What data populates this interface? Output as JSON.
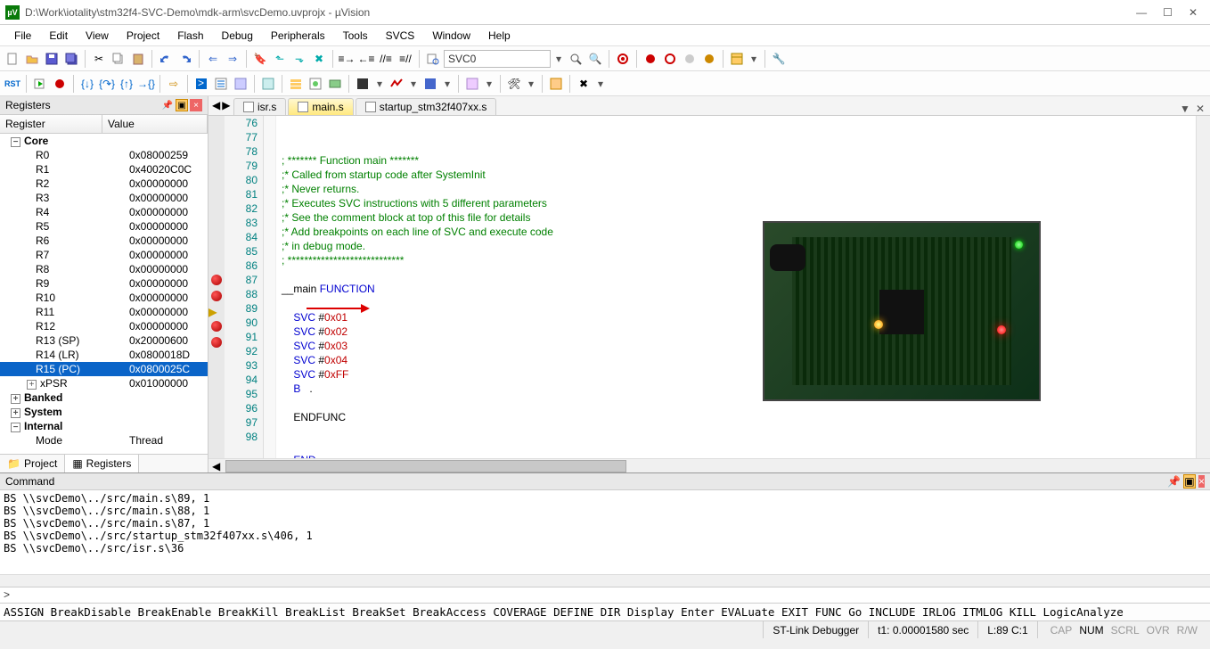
{
  "title": "D:\\Work\\iotality\\stm32f4-SVC-Demo\\mdk-arm\\svcDemo.uvprojx - µVision",
  "menus": [
    "File",
    "Edit",
    "View",
    "Project",
    "Flash",
    "Debug",
    "Peripherals",
    "Tools",
    "SVCS",
    "Window",
    "Help"
  ],
  "toolbar1_search_box": "SVC0",
  "registers": {
    "panel_title": "Registers",
    "col_name": "Register",
    "col_value": "Value",
    "groups": [
      {
        "name": "Core",
        "expanded": true,
        "children": [
          {
            "name": "R0",
            "value": "0x08000259"
          },
          {
            "name": "R1",
            "value": "0x40020C0C"
          },
          {
            "name": "R2",
            "value": "0x00000000"
          },
          {
            "name": "R3",
            "value": "0x00000000"
          },
          {
            "name": "R4",
            "value": "0x00000000"
          },
          {
            "name": "R5",
            "value": "0x00000000"
          },
          {
            "name": "R6",
            "value": "0x00000000"
          },
          {
            "name": "R7",
            "value": "0x00000000"
          },
          {
            "name": "R8",
            "value": "0x00000000"
          },
          {
            "name": "R9",
            "value": "0x00000000"
          },
          {
            "name": "R10",
            "value": "0x00000000"
          },
          {
            "name": "R11",
            "value": "0x00000000"
          },
          {
            "name": "R12",
            "value": "0x00000000"
          },
          {
            "name": "R13 (SP)",
            "value": "0x20000600"
          },
          {
            "name": "R14 (LR)",
            "value": "0x0800018D"
          },
          {
            "name": "R15 (PC)",
            "value": "0x0800025C",
            "selected": true
          },
          {
            "name": "xPSR",
            "value": "0x01000000",
            "toggle": "+"
          }
        ]
      },
      {
        "name": "Banked",
        "expanded": false
      },
      {
        "name": "System",
        "expanded": false
      },
      {
        "name": "Internal",
        "expanded": true,
        "children": [
          {
            "name": "Mode",
            "value": "Thread"
          }
        ]
      }
    ],
    "tabs": [
      "Project",
      "Registers"
    ],
    "active_tab": 1
  },
  "editor": {
    "tabs": [
      {
        "label": "isr.s",
        "active": false
      },
      {
        "label": "main.s",
        "active": true
      },
      {
        "label": "startup_stm32f407xx.s",
        "active": false
      }
    ],
    "lines": [
      {
        "n": 76,
        "bp": false,
        "t": "; ******* Function main *******",
        "cls": "kw-comment"
      },
      {
        "n": 77,
        "bp": false,
        "t": ";* Called from startup code after SystemInit",
        "cls": "kw-comment"
      },
      {
        "n": 78,
        "bp": false,
        "t": ";* Never returns.",
        "cls": "kw-comment"
      },
      {
        "n": 79,
        "bp": false,
        "t": ";* Executes SVC instructions with 5 different parameters",
        "cls": "kw-comment"
      },
      {
        "n": 80,
        "bp": false,
        "t": ";* See the comment block at top of this file for details",
        "cls": "kw-comment"
      },
      {
        "n": 81,
        "bp": false,
        "t": ";* Add breakpoints on each line of SVC and execute code",
        "cls": "kw-comment"
      },
      {
        "n": 82,
        "bp": false,
        "t": ";* in debug mode.",
        "cls": "kw-comment"
      },
      {
        "n": 83,
        "bp": false,
        "t": "; ****************************",
        "cls": "kw-comment"
      },
      {
        "n": 84,
        "bp": false,
        "t": ""
      },
      {
        "n": 85,
        "bp": false,
        "seg": [
          {
            "t": "__main ",
            "cls": "kw-black"
          },
          {
            "t": "FUNCTION",
            "cls": "kw-blue"
          }
        ]
      },
      {
        "n": 86,
        "bp": false,
        "t": ""
      },
      {
        "n": 87,
        "bp": true,
        "seg": [
          {
            "t": "    SVC ",
            "cls": "kw-blue"
          },
          {
            "t": "#",
            "cls": "kw-black"
          },
          {
            "t": "0x01",
            "cls": "kw-red"
          }
        ]
      },
      {
        "n": 88,
        "bp": true,
        "seg": [
          {
            "t": "    SVC ",
            "cls": "kw-blue"
          },
          {
            "t": "#",
            "cls": "kw-black"
          },
          {
            "t": "0x02",
            "cls": "kw-red"
          }
        ]
      },
      {
        "n": 89,
        "bp": true,
        "pc": true,
        "seg": [
          {
            "t": "    SVC ",
            "cls": "kw-blue"
          },
          {
            "t": "#",
            "cls": "kw-black"
          },
          {
            "t": "0x03",
            "cls": "kw-red"
          }
        ]
      },
      {
        "n": 90,
        "bp": true,
        "seg": [
          {
            "t": "    SVC ",
            "cls": "kw-blue"
          },
          {
            "t": "#",
            "cls": "kw-black"
          },
          {
            "t": "0x04",
            "cls": "kw-red"
          }
        ]
      },
      {
        "n": 91,
        "bp": true,
        "seg": [
          {
            "t": "    SVC ",
            "cls": "kw-blue"
          },
          {
            "t": "#",
            "cls": "kw-black"
          },
          {
            "t": "0xFF",
            "cls": "kw-red"
          }
        ]
      },
      {
        "n": 92,
        "bp": false,
        "seg": [
          {
            "t": "    B   ",
            "cls": "kw-blue"
          },
          {
            "t": ".",
            "cls": "kw-black"
          }
        ]
      },
      {
        "n": 93,
        "bp": false,
        "t": ""
      },
      {
        "n": 94,
        "bp": false,
        "seg": [
          {
            "t": "    ENDFUNC",
            "cls": "kw-black"
          }
        ]
      },
      {
        "n": 95,
        "bp": false,
        "t": ""
      },
      {
        "n": 96,
        "bp": false,
        "t": ""
      },
      {
        "n": 97,
        "bp": false,
        "seg": [
          {
            "t": "    END",
            "cls": "kw-blue"
          }
        ]
      },
      {
        "n": 98,
        "bp": false,
        "t": ""
      }
    ]
  },
  "command": {
    "title": "Command",
    "lines": [
      "BS \\\\svcDemo\\../src/main.s\\89, 1",
      "BS \\\\svcDemo\\../src/main.s\\88, 1",
      "BS \\\\svcDemo\\../src/main.s\\87, 1",
      "BS \\\\svcDemo\\../src/startup_stm32f407xx.s\\406, 1",
      "BS \\\\svcDemo\\../src/isr.s\\36"
    ],
    "prompt": ">",
    "help": "ASSIGN BreakDisable BreakEnable BreakKill BreakList BreakSet BreakAccess COVERAGE DEFINE DIR Display Enter EVALuate EXIT FUNC Go INCLUDE IRLOG ITMLOG KILL LogicAnalyze"
  },
  "status": {
    "debugger": "ST-Link Debugger",
    "time": "t1: 0.00001580 sec",
    "cursor": "L:89 C:1",
    "indicators": [
      "CAP",
      "NUM",
      "SCRL",
      "OVR",
      "R/W"
    ],
    "active_indicator": 1
  }
}
